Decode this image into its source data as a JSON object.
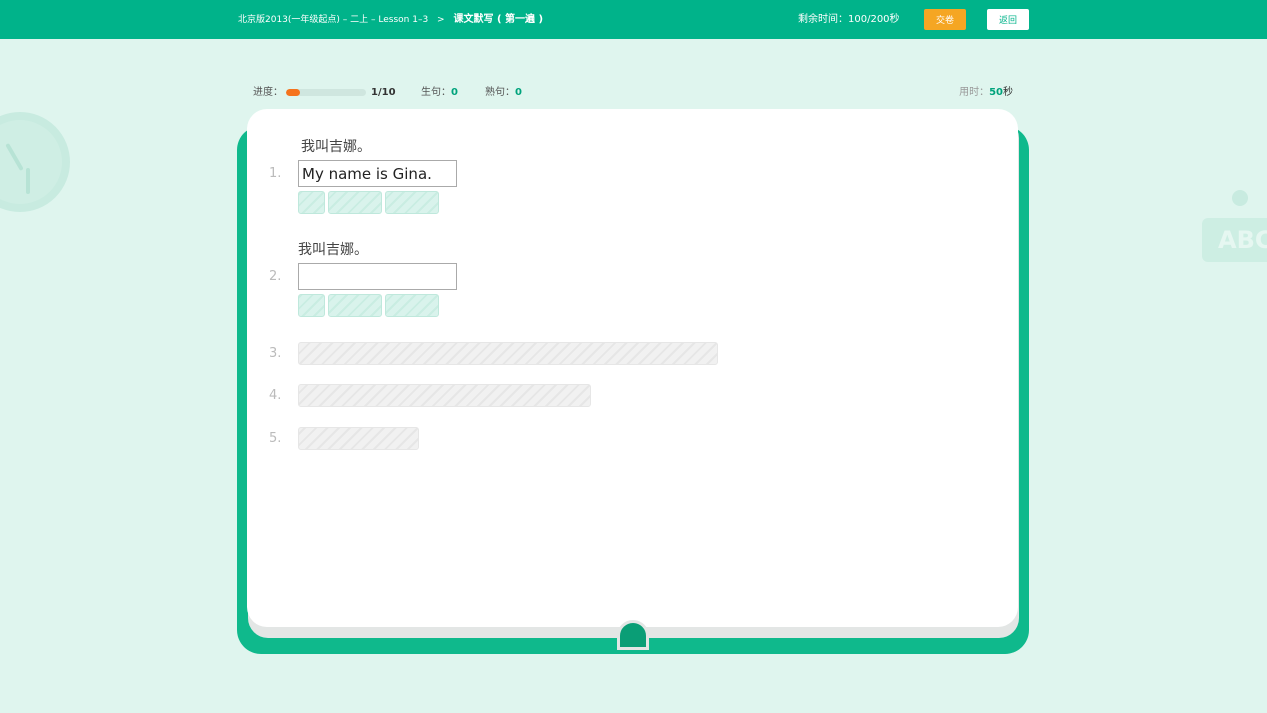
{
  "topbar": {
    "crumb_path": "北京版2013(一年级起点) – 二上 – Lesson 1–3",
    "crumb_separator": ">",
    "crumb_current": "课文默写 ( 第一遍 )",
    "timer_label": "剩余时间：",
    "timer_value": "100/200秒",
    "submit_label": "交卷",
    "back_label": "返回"
  },
  "status": {
    "progress_label": "进度：",
    "progress_current": "1",
    "progress_total": "/10",
    "progress_fraction": 0.17,
    "new_label": "生句：",
    "new_count": "0",
    "familiar_label": "熟句：",
    "familiar_count": "0",
    "time_label": "用时：",
    "time_value": "50",
    "time_unit": "秒"
  },
  "questions": [
    {
      "num": "1.",
      "chinese": "我叫吉娜。",
      "answer": "My name is Gina."
    },
    {
      "num": "2.",
      "chinese": "我叫吉娜。",
      "answer": ""
    },
    {
      "num": "3."
    },
    {
      "num": "4."
    },
    {
      "num": "5."
    }
  ],
  "decor": {
    "abc_text": "ABC"
  },
  "colors": {
    "brand": "#00b38a",
    "accent_orange": "#f5a623",
    "progress": "#f5731d",
    "background": "#dff5ee"
  }
}
